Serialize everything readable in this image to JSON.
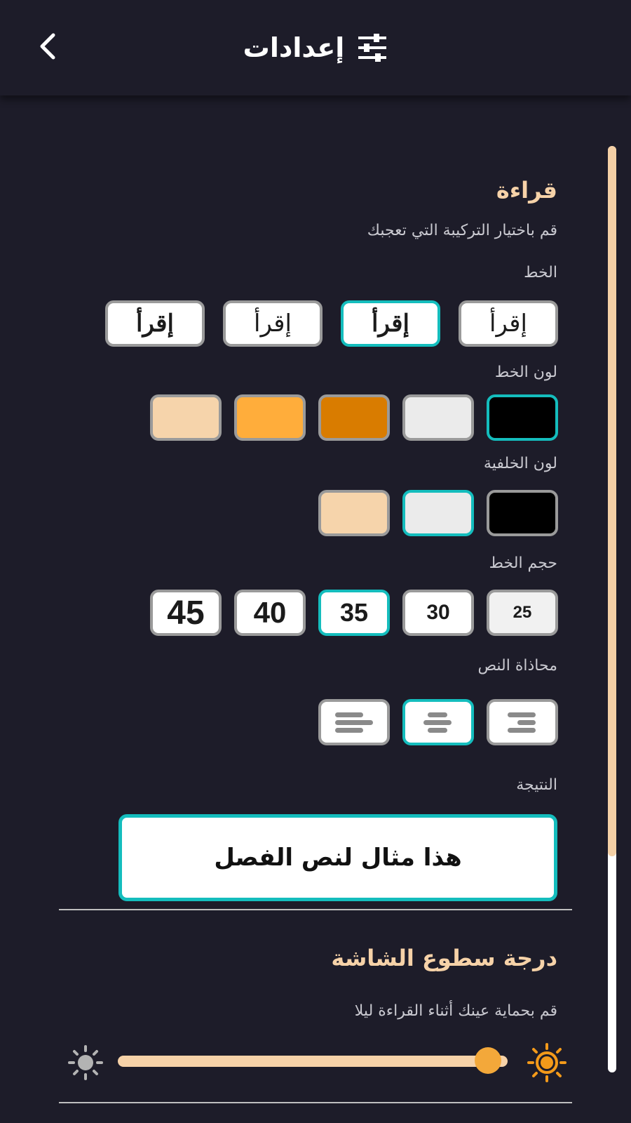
{
  "header": {
    "title": "إعدادات",
    "back_icon": "chevron-left-icon",
    "settings_icon": "sliders-icon"
  },
  "reading": {
    "title": "قراءة",
    "subtitle": "قم باختيار التركيبة التي تعجبك",
    "font_label": "الخط",
    "font_options": [
      {
        "label": "إقرأ",
        "selected": false
      },
      {
        "label": "إقرأ",
        "selected": true
      },
      {
        "label": "إقرأ",
        "selected": false
      },
      {
        "label": "إقرأ",
        "selected": false
      }
    ],
    "font_color_label": "لون الخط",
    "font_colors": [
      {
        "color": "#000000",
        "selected": true
      },
      {
        "color": "#ebebeb",
        "selected": false
      },
      {
        "color": "#d97c00",
        "selected": false
      },
      {
        "color": "#ffad3b",
        "selected": false
      },
      {
        "color": "#f6d4ab",
        "selected": false
      }
    ],
    "bg_color_label": "لون الخلفية",
    "bg_colors": [
      {
        "color": "#000000",
        "selected": false
      },
      {
        "color": "#ebebeb",
        "selected": true
      },
      {
        "color": "#f6d4ab",
        "selected": false
      }
    ],
    "font_size_label": "حجم الخط",
    "font_sizes": [
      {
        "label": "25",
        "selected": false
      },
      {
        "label": "30",
        "selected": false
      },
      {
        "label": "35",
        "selected": true
      },
      {
        "label": "40",
        "selected": false
      },
      {
        "label": "45",
        "selected": false
      }
    ],
    "alignment_label": "محاذاة النص",
    "alignments": [
      {
        "name": "align-right-icon",
        "selected": false
      },
      {
        "name": "align-center-icon",
        "selected": true
      },
      {
        "name": "align-left-icon",
        "selected": false
      }
    ],
    "result_label": "النتيجة",
    "result_text": "هذا مثال لنص الفصل"
  },
  "brightness": {
    "title": "درجة سطوع الشاشة",
    "subtitle": "قم بحماية عينك أثناء القراءة ليلا",
    "level": 0.95,
    "high_icon": "sun-icon",
    "low_icon": "sun-dim-icon"
  },
  "colors": {
    "accent": "#14bdbd",
    "heading": "#f6d2a8",
    "slider": "#f3a83a",
    "background": "#1d1c29"
  }
}
